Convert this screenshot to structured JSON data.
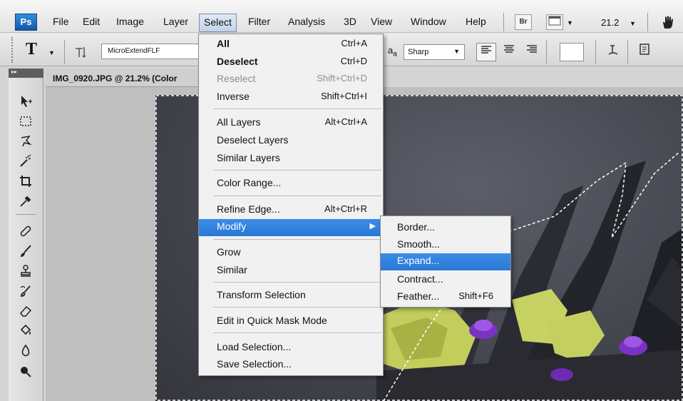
{
  "app": {
    "logo": "Ps"
  },
  "menubar": {
    "items": [
      "File",
      "Edit",
      "Image",
      "Layer",
      "Select",
      "Filter",
      "Analysis",
      "3D",
      "View",
      "Window",
      "Help"
    ],
    "bridge_button": "Br",
    "zoom": "21.2",
    "icons": {
      "screen-mode": "screen-mode-icon",
      "hand": "hand-icon"
    }
  },
  "options": {
    "tool_letter": "T",
    "font_family": "MicroExtendFLF",
    "aa_symbol": "a",
    "aa_sub": "a",
    "anti_alias": "Sharp"
  },
  "document": {
    "tab_title": "IMG_0920.JPG @ 21.2% (Color"
  },
  "select_menu": {
    "items": [
      {
        "label": "All",
        "shortcut": "Ctrl+A"
      },
      {
        "label": "Deselect",
        "shortcut": "Ctrl+D"
      },
      {
        "label": "Reselect",
        "shortcut": "Shift+Ctrl+D",
        "disabled": true
      },
      {
        "label": "Inverse",
        "shortcut": "Shift+Ctrl+I"
      },
      {
        "label": "All Layers",
        "shortcut": "Alt+Ctrl+A"
      },
      {
        "label": "Deselect Layers",
        "shortcut": ""
      },
      {
        "label": "Similar Layers",
        "shortcut": ""
      },
      {
        "label": "Color Range...",
        "shortcut": ""
      },
      {
        "label": "Refine Edge...",
        "shortcut": "Alt+Ctrl+R"
      },
      {
        "label": "Modify",
        "shortcut": "",
        "submenu": true,
        "highlighted": true
      },
      {
        "label": "Grow",
        "shortcut": ""
      },
      {
        "label": "Similar",
        "shortcut": ""
      },
      {
        "label": "Transform Selection",
        "shortcut": ""
      },
      {
        "label": "Edit in Quick Mask Mode",
        "shortcut": ""
      },
      {
        "label": "Load Selection...",
        "shortcut": ""
      },
      {
        "label": "Save Selection...",
        "shortcut": ""
      }
    ]
  },
  "modify_menu": {
    "items": [
      {
        "label": "Border...",
        "shortcut": ""
      },
      {
        "label": "Smooth...",
        "shortcut": ""
      },
      {
        "label": "Expand...",
        "shortcut": "",
        "highlighted": true
      },
      {
        "label": "Contract...",
        "shortcut": ""
      },
      {
        "label": "Feather...",
        "shortcut": "Shift+F6"
      }
    ]
  },
  "colors": {
    "highlight": "#2a78d6",
    "canvas": "#43454d",
    "lego_green": "#c4cf62",
    "lego_purple": "#8a3fd1"
  }
}
